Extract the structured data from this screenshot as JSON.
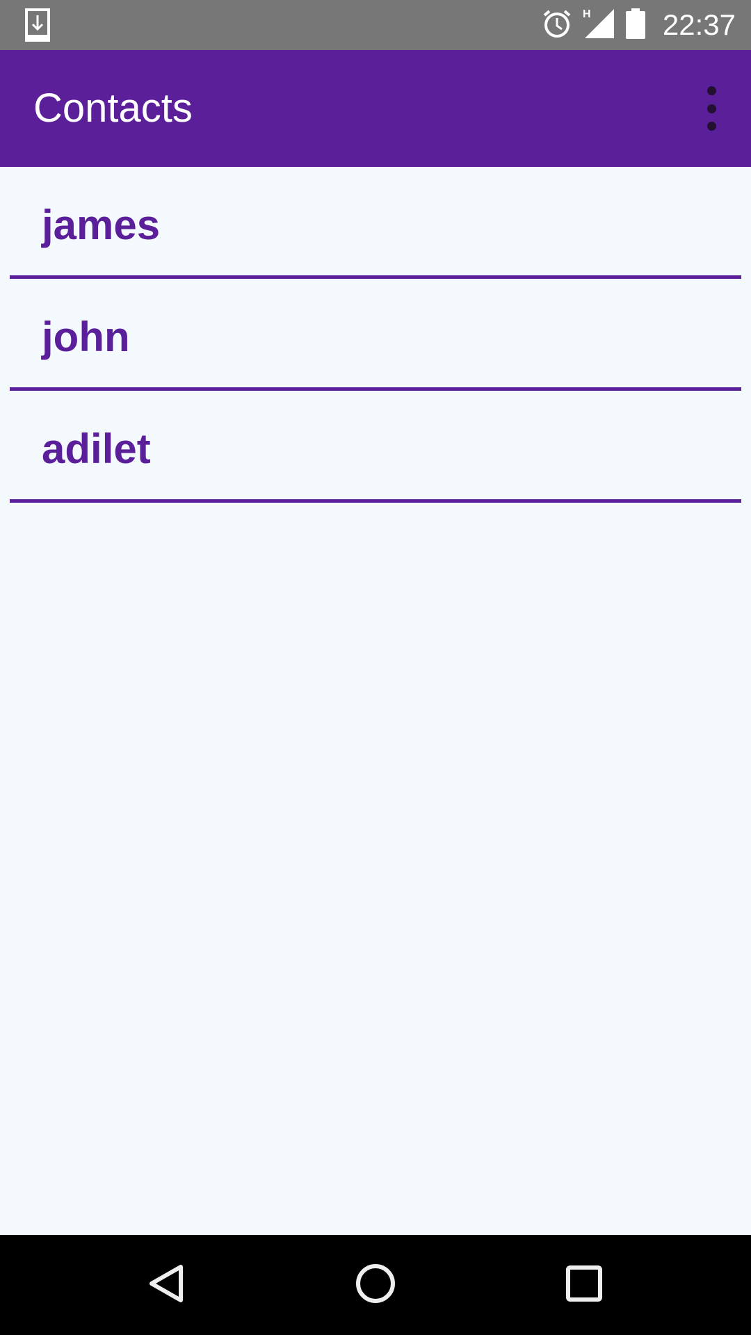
{
  "status_bar": {
    "time": "22:37",
    "network_type": "H",
    "icons": [
      "download-notification-icon",
      "alarm-icon",
      "signal-icon",
      "battery-icon"
    ]
  },
  "toolbar": {
    "title": "Contacts",
    "overflow_icon": "more-vert-icon"
  },
  "contacts": [
    {
      "name": "james"
    },
    {
      "name": "john"
    },
    {
      "name": "adilet"
    }
  ],
  "nav_bar": {
    "icons": [
      "back-icon",
      "home-icon",
      "recents-icon"
    ]
  },
  "colors": {
    "primary": "#5b1f9a",
    "status_bar": "#777777",
    "background": "#f3f9fd",
    "nav_bar": "#000000"
  }
}
